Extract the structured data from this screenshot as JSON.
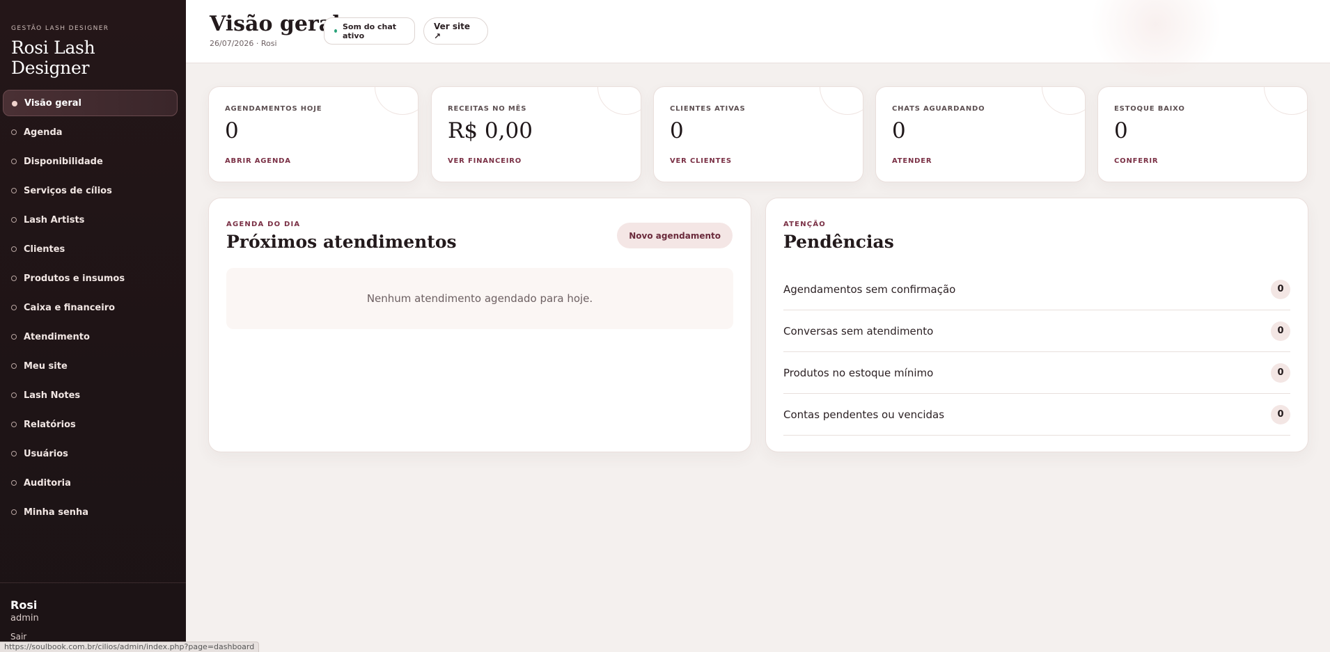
{
  "brand": {
    "kicker": "GESTÃO LASH DESIGNER",
    "title": "Rosi Lash Designer"
  },
  "nav": [
    {
      "label": "Visão geral",
      "active": true
    },
    {
      "label": "Agenda"
    },
    {
      "label": "Disponibilidade"
    },
    {
      "label": "Serviços de cílios"
    },
    {
      "label": "Lash Artists"
    },
    {
      "label": "Clientes"
    },
    {
      "label": "Produtos e insumos"
    },
    {
      "label": "Caixa e financeiro"
    },
    {
      "label": "Atendimento"
    },
    {
      "label": "Meu site"
    },
    {
      "label": "Lash Notes"
    },
    {
      "label": "Relatórios"
    },
    {
      "label": "Usuários"
    },
    {
      "label": "Auditoria"
    },
    {
      "label": "Minha senha"
    }
  ],
  "user": {
    "name": "Rosi",
    "role": "admin",
    "logout": "Sair"
  },
  "statusbar": "https://soulbook.com.br/cilios/admin/index.php?page=dashboard",
  "header": {
    "title": "Visão geral",
    "subtitle": "26/07/2026 · Rosi",
    "chat_chip": "Som do chat ativo",
    "site_chip": "Ver site ↗"
  },
  "stats": [
    {
      "label": "AGENDAMENTOS HOJE",
      "value": "0",
      "link": "ABRIR AGENDA"
    },
    {
      "label": "RECEITAS NO MÊS",
      "value": "R$ 0,00",
      "link": "VER FINANCEIRO"
    },
    {
      "label": "CLIENTES ATIVAS",
      "value": "0",
      "link": "VER CLIENTES"
    },
    {
      "label": "CHATS AGUARDANDO",
      "value": "0",
      "link": "ATENDER"
    },
    {
      "label": "ESTOQUE BAIXO",
      "value": "0",
      "link": "CONFERIR"
    }
  ],
  "agenda": {
    "kicker": "AGENDA DO DIA",
    "title": "Próximos atendimentos",
    "new_button": "Novo agendamento",
    "empty_text": "Nenhum atendimento agendado para hoje."
  },
  "pendencias": {
    "kicker": "ATENÇÃO",
    "title": "Pendências",
    "items": [
      {
        "label": "Agendamentos sem confirmação",
        "count": "0"
      },
      {
        "label": "Conversas sem atendimento",
        "count": "0"
      },
      {
        "label": "Produtos no estoque mínimo",
        "count": "0"
      },
      {
        "label": "Contas pendentes ou vencidas",
        "count": "0"
      }
    ]
  },
  "colors": {
    "sidebar_bg": "#1e1416",
    "accent": "#7a3045",
    "page_bg": "#f4f0ee",
    "live_dot": "#2aa37a"
  }
}
